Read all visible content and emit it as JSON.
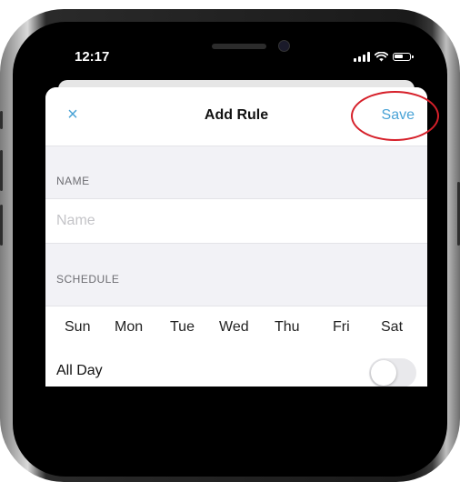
{
  "status_bar": {
    "time": "12:17"
  },
  "nav": {
    "close_glyph": "×",
    "title": "Add Rule",
    "save_label": "Save"
  },
  "name_section": {
    "header": "NAME",
    "placeholder": "Name",
    "value": ""
  },
  "schedule_section": {
    "header": "SCHEDULE",
    "days": [
      "Sun",
      "Mon",
      "Tue",
      "Wed",
      "Thu",
      "Fri",
      "Sat"
    ]
  },
  "all_day": {
    "label": "All Day",
    "enabled": false
  },
  "colors": {
    "accent": "#4aa3d6",
    "annotation": "#d6202a"
  },
  "icons": [
    "close-icon",
    "signal-icon",
    "wifi-icon",
    "battery-icon"
  ]
}
